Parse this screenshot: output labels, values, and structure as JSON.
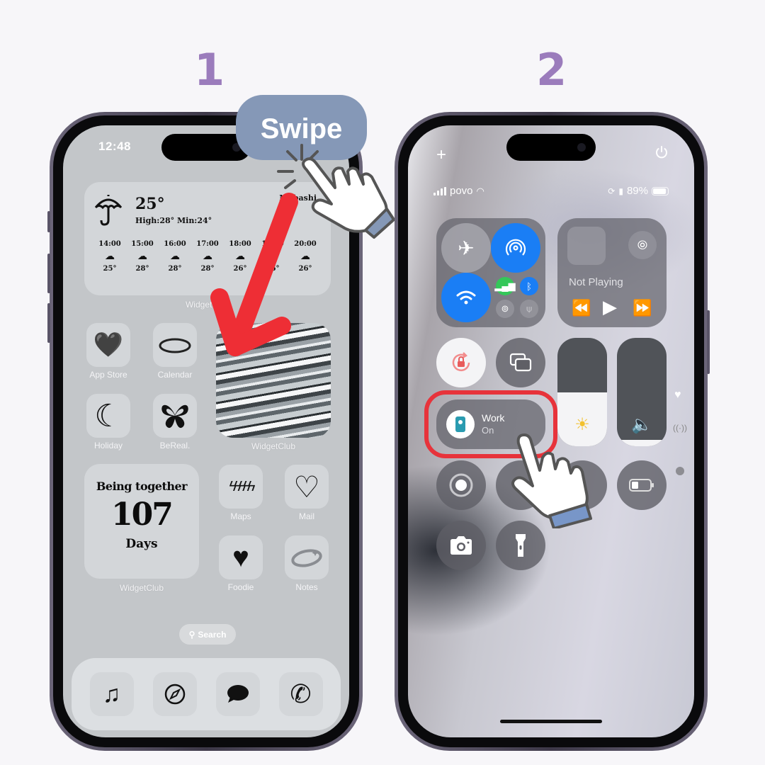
{
  "steps": [
    "1",
    "2"
  ],
  "annotation": {
    "swipe_label": "Swipe"
  },
  "home_screen": {
    "time": "12:48",
    "weather": {
      "current_temp": "25°",
      "high_low": "High:28° Min:24°",
      "city": "Mobashi",
      "hours": [
        {
          "time": "14:00",
          "icon": "cloud-icon",
          "temp": "25°"
        },
        {
          "time": "15:00",
          "icon": "cloud-icon",
          "temp": "28°"
        },
        {
          "time": "16:00",
          "icon": "cloud-icon",
          "temp": "28°"
        },
        {
          "time": "17:00",
          "icon": "cloud-icon",
          "temp": "28°"
        },
        {
          "time": "18:00",
          "icon": "cloud-icon",
          "temp": "26°"
        },
        {
          "time": "19:00",
          "icon": "cloud-icon",
          "temp": "26°"
        },
        {
          "time": "20:00",
          "icon": "cloud-icon",
          "temp": "26°"
        }
      ],
      "widget_label": "WidgetClub"
    },
    "apps": [
      {
        "label": "App Store",
        "icon": "heart-icon"
      },
      {
        "label": "Calendar",
        "icon": "ring-icon"
      },
      {
        "label": "Holiday",
        "icon": "moon-icon"
      },
      {
        "label": "BeReal.",
        "icon": "butterfly-icon"
      },
      {
        "label": "Maps",
        "icon": "lightning-icon"
      },
      {
        "label": "Mail",
        "icon": "heart-outline-icon"
      },
      {
        "label": "Foodie",
        "icon": "black-heart-icon"
      },
      {
        "label": "Notes",
        "icon": "chrome-ring-icon"
      }
    ],
    "marble_widget_label": "WidgetClub",
    "together_widget": {
      "line1": "Being together",
      "count": "107",
      "unit": "Days",
      "label": "WidgetClub"
    },
    "search_label": "Search",
    "dock": [
      {
        "name": "music",
        "glyph": "♫"
      },
      {
        "name": "safari",
        "glyph": "⊘"
      },
      {
        "name": "messages",
        "glyph": "💬"
      },
      {
        "name": "phone",
        "glyph": "✆"
      }
    ]
  },
  "control_center": {
    "carrier": "povo",
    "battery_percent": "89%",
    "battery_level": 0.89,
    "now_playing": "Not Playing",
    "focus": {
      "label": "Work",
      "status": "On"
    },
    "brightness_level": 0.5,
    "volume_level": 0.06,
    "colors": {
      "active_blue": "#1a7ef5",
      "cellular_green": "#34c759",
      "highlight_red": "#e7333b",
      "focus_teal": "#2a9bb0",
      "step_purple": "#9b7cbc",
      "swipe_blue": "#8598b7"
    }
  }
}
